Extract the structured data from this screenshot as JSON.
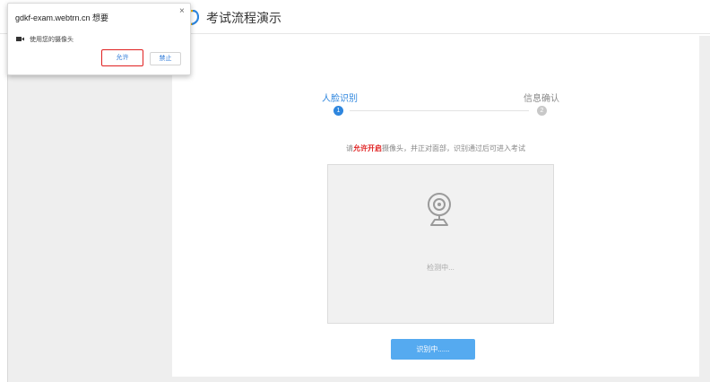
{
  "header": {
    "title": "考试流程演示",
    "logo_icon": "exam-logo-icon"
  },
  "steps": [
    {
      "label": "人脸识别",
      "number": "1",
      "state": "active"
    },
    {
      "label": "信息确认",
      "number": "2",
      "state": "pending"
    }
  ],
  "instruction": {
    "prefix": "请",
    "highlight": "允许开启",
    "suffix": "摄像头，并正对面部，识别通过后可进入考试"
  },
  "camera": {
    "icon": "webcam-icon",
    "status": "检测中..."
  },
  "recognize_button": {
    "label": "识别中......"
  },
  "permission_popup": {
    "title": "gdkf-exam.webtrn.cn 想要",
    "close": "×",
    "camera_icon": "video-camera-icon",
    "request": "使用您的摄像头",
    "allow_label": "允许",
    "deny_label": "禁止"
  },
  "colors": {
    "accent": "#2e86de",
    "button": "#55aaf0",
    "highlight": "#e02424",
    "panel_gray": "#eeeeee"
  }
}
